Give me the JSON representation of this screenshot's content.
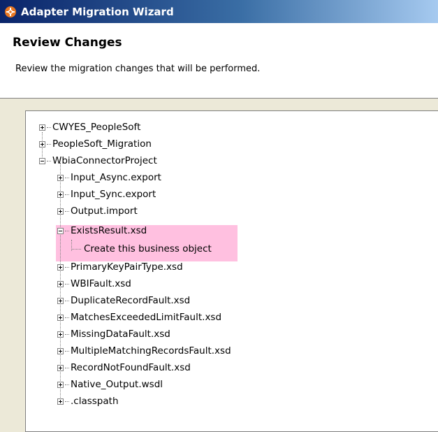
{
  "window": {
    "title": "Adapter Migration Wizard"
  },
  "header": {
    "title": "Review Changes",
    "description": "Review the migration changes that will be performed."
  },
  "tree": {
    "projects": [
      {
        "label": "CWYES_PeopleSoft",
        "expanded": false
      },
      {
        "label": "PeopleSoft_Migration",
        "expanded": false
      },
      {
        "label": "WbiaConnectorProject",
        "expanded": true
      }
    ],
    "children": [
      {
        "label": "Input_Async.export",
        "expanded": false
      },
      {
        "label": "Input_Sync.export",
        "expanded": false
      },
      {
        "label": "Output.import",
        "expanded": false
      },
      {
        "label": "ExistsResult.xsd",
        "expanded": true,
        "highlighted": true
      },
      {
        "label": "PrimaryKeyPairType.xsd",
        "expanded": false
      },
      {
        "label": "WBIFault.xsd",
        "expanded": false
      },
      {
        "label": "DuplicateRecordFault.xsd",
        "expanded": false
      },
      {
        "label": "MatchesExceededLimitFault.xsd",
        "expanded": false
      },
      {
        "label": "MissingDataFault.xsd",
        "expanded": false
      },
      {
        "label": "MultipleMatchingRecordsFault.xsd",
        "expanded": false
      },
      {
        "label": "RecordNotFoundFault.xsd",
        "expanded": false
      },
      {
        "label": "Native_Output.wsdl",
        "expanded": false
      },
      {
        "label": ".classpath",
        "expanded": false
      }
    ],
    "change_item": {
      "label": "Create this business object"
    }
  },
  "colors": {
    "highlight": "#ffc0e0",
    "titlebar_start": "#0a246a",
    "titlebar_end": "#a6caf0"
  }
}
